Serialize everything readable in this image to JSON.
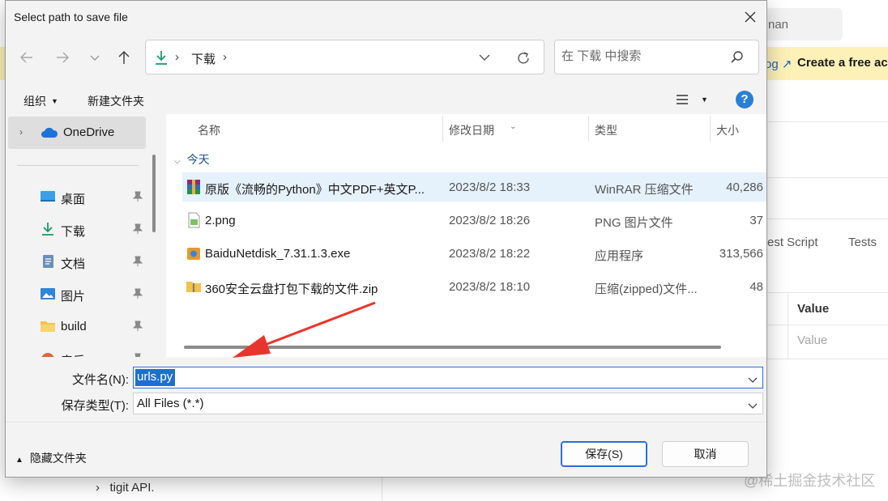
{
  "background_app": {
    "search_fragment": "nan",
    "banner_link": "og ↗",
    "banner_cta": "Create a free ac",
    "tabs": [
      "est Script",
      "Tests"
    ],
    "value_header": "Value",
    "value_placeholder": "Value",
    "sidebar_item": "tigit API.",
    "watermark": "@稀土掘金技术社区"
  },
  "dialog": {
    "title": "Select path to save file",
    "address": {
      "separator": "›",
      "folder": "下载"
    },
    "search": {
      "placeholder": "在 下载 中搜索"
    },
    "commands": {
      "organize": "组织",
      "new_folder": "新建文件夹",
      "help": "?"
    },
    "nav": {
      "onedrive": "OneDrive",
      "items": [
        {
          "label": "桌面",
          "icon": "desktop-icon"
        },
        {
          "label": "下载",
          "icon": "download-icon"
        },
        {
          "label": "文档",
          "icon": "documents-icon"
        },
        {
          "label": "图片",
          "icon": "pictures-icon"
        },
        {
          "label": "build",
          "icon": "folder-icon"
        },
        {
          "label": "音乐",
          "icon": "music-icon"
        }
      ]
    },
    "columns": {
      "name": "名称",
      "date": "修改日期",
      "type": "类型",
      "size": "大小"
    },
    "group": "今天",
    "files": [
      {
        "name": "原版《流畅的Python》中文PDF+英文P...",
        "date": "2023/8/2 18:33",
        "type": "WinRAR 压缩文件",
        "size": "40,286",
        "icon": "winrar-archive-icon",
        "selected": true
      },
      {
        "name": "2.png",
        "date": "2023/8/2 18:26",
        "type": "PNG 图片文件",
        "size": "37",
        "icon": "png-file-icon",
        "selected": false
      },
      {
        "name": "BaiduNetdisk_7.31.1.3.exe",
        "date": "2023/8/2 18:22",
        "type": "应用程序",
        "size": "313,566",
        "icon": "exe-installer-icon",
        "selected": false
      },
      {
        "name": "360安全云盘打包下载的文件.zip",
        "date": "2023/8/2 18:10",
        "type": "压缩(zipped)文件...",
        "size": "48",
        "icon": "zip-folder-icon",
        "selected": false
      }
    ],
    "form": {
      "filename_label": "文件名(N):",
      "filename_value": "urls.py",
      "filetype_label": "保存类型(T):",
      "filetype_value": "All Files (*.*)"
    },
    "hide_folders": "隐藏文件夹",
    "save_button": "保存(S)",
    "cancel_button": "取消"
  },
  "colors": {
    "accent": "#2b6fd6",
    "selection": "#e5f1fb",
    "banner": "#fdf1b8",
    "arrow": "#e8352c"
  }
}
